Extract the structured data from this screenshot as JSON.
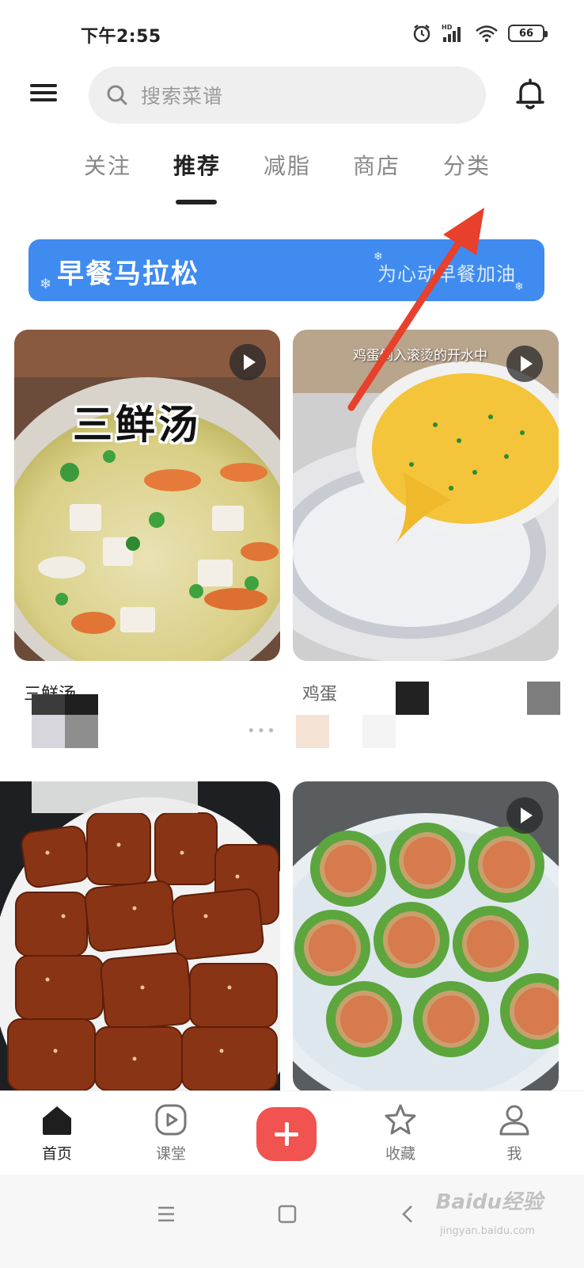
{
  "status_bar": {
    "time": "下午2:55",
    "hd_label": "HD",
    "battery": "66",
    "icons": [
      "alarm-icon",
      "signal-icon",
      "wifi-icon",
      "battery-icon"
    ]
  },
  "header": {
    "search_placeholder": "搜索菜谱",
    "icons": [
      "menu-icon",
      "search-icon",
      "bell-icon"
    ]
  },
  "tabs": [
    {
      "label": "关注",
      "active": false
    },
    {
      "label": "推荐",
      "active": true
    },
    {
      "label": "减脂",
      "active": false
    },
    {
      "label": "商店",
      "active": false
    },
    {
      "label": "分类",
      "active": false
    }
  ],
  "banner": {
    "title": "早餐马拉松",
    "subtitle": "为心动早餐加油",
    "color": "#3f8bf0"
  },
  "feed": [
    {
      "overlay_title": "三鲜汤",
      "title": "三鲜汤",
      "has_video": true
    },
    {
      "overlay_caption": "鸡蛋倒入滚烫的开水中",
      "title": "鸡蛋",
      "has_video": true
    },
    {
      "title": "",
      "has_video": false
    },
    {
      "title": "",
      "has_video": true
    }
  ],
  "bottom_nav": [
    {
      "label": "首页",
      "icon": "home-icon",
      "active": true
    },
    {
      "label": "课堂",
      "icon": "video-icon",
      "active": false
    },
    {
      "label": "",
      "icon": "plus-icon",
      "active": false
    },
    {
      "label": "收藏",
      "icon": "star-icon",
      "active": false
    },
    {
      "label": "我",
      "icon": "user-icon",
      "active": false
    }
  ],
  "system_nav": {
    "icons": [
      "menu-lines-icon",
      "square-icon",
      "back-icon"
    ],
    "watermark": "Baidu经验",
    "watermark_sub": "jingyan.baidu.com"
  },
  "colors": {
    "accent_red": "#f05350",
    "annotation_arrow": "#e8402a"
  }
}
